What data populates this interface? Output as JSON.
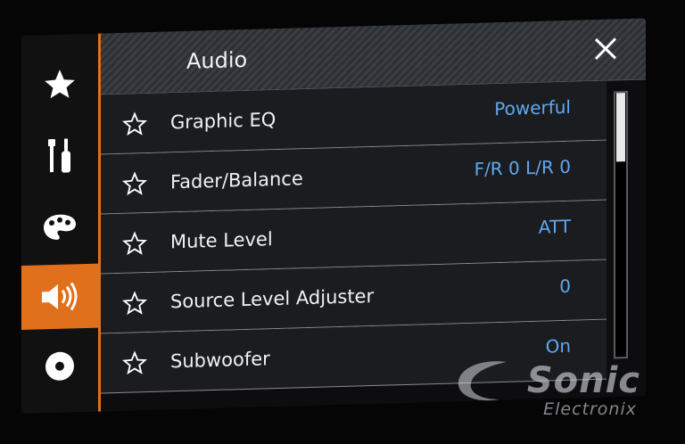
{
  "header": {
    "title": "Audio",
    "close_icon": "close-icon"
  },
  "sidebar": {
    "items": [
      {
        "name": "favorites",
        "icon": "star-icon",
        "active": false
      },
      {
        "name": "system",
        "icon": "tools-icon",
        "active": false
      },
      {
        "name": "theme",
        "icon": "palette-icon",
        "active": false
      },
      {
        "name": "audio",
        "icon": "speaker-icon",
        "active": true
      },
      {
        "name": "video",
        "icon": "disc-icon",
        "active": false
      }
    ]
  },
  "rows": [
    {
      "label": "Graphic EQ",
      "value": "Powerful",
      "icon": "star-outline-icon"
    },
    {
      "label": "Fader/Balance",
      "value": "F/R 0 L/R 0",
      "icon": "star-outline-icon"
    },
    {
      "label": "Mute Level",
      "value": "ATT",
      "icon": "star-outline-icon"
    },
    {
      "label": "Source Level Adjuster",
      "value": "0",
      "icon": "star-outline-icon"
    },
    {
      "label": "Subwoofer",
      "value": "On",
      "icon": "star-outline-icon"
    }
  ],
  "scrollbar": {
    "position": 0,
    "visible_fraction": 0.26
  },
  "watermark": {
    "line1": "Sonic",
    "line2": "Electronix"
  },
  "colors": {
    "accent": "#e0701b",
    "value_text": "#5fa8ef",
    "row_bg": "#1b1c1f"
  }
}
